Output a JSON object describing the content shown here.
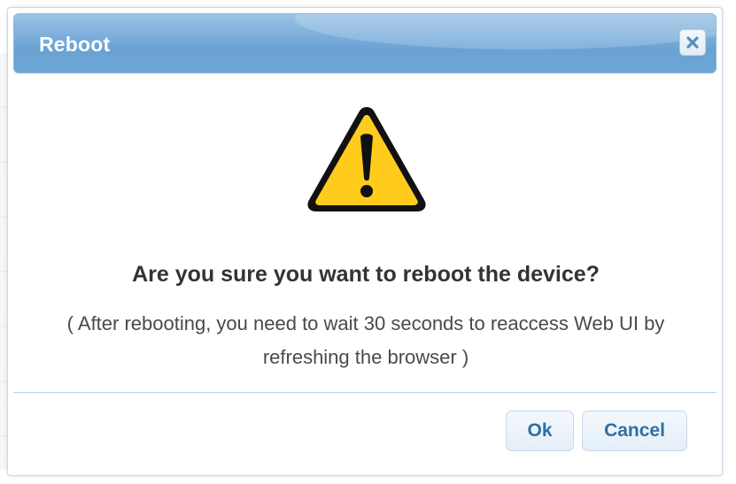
{
  "dialog": {
    "title": "Reboot",
    "close_icon": "close-icon",
    "warning_icon": "warning-triangle-icon",
    "question": "Are you sure you want to reboot the device?",
    "note": "( After rebooting, you need to wait 30 seconds to reaccess Web UI by refreshing the browser )",
    "buttons": {
      "ok_label": "Ok",
      "cancel_label": "Cancel"
    }
  },
  "colors": {
    "titlebar": "#7fb0dc",
    "title_text": "#ffffff",
    "button_text": "#2f6fa3",
    "warning_fill": "#ffcc1e",
    "warning_outline": "#111111"
  }
}
